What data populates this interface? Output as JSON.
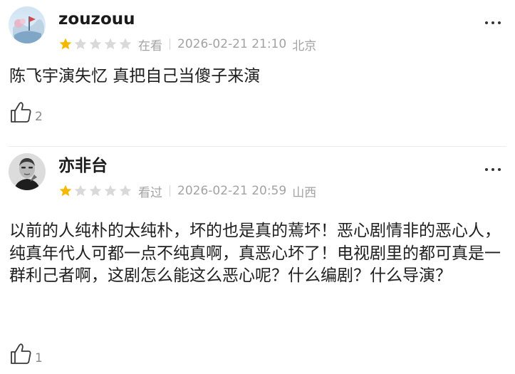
{
  "reviews": [
    {
      "username": "zouzouu",
      "rating": 1,
      "max_rating": 5,
      "status": "在看",
      "time": "2026-02-21 21:10",
      "location": "北京",
      "content": "陈飞宇演失忆 真把自己当傻子来演",
      "likes": "2"
    },
    {
      "username": "亦非台",
      "rating": 1,
      "max_rating": 5,
      "status": "看过",
      "time": "2026-02-21 20:59",
      "location": "山西",
      "content": "以前的人纯朴的太纯朴，坏的也是真的蔫坏！恶心剧情非的恶心人，纯真年代人可都一点不纯真啊，真恶心坏了！电视剧里的都可真是一群利己者啊，这剧怎么能这么恶心呢？什么编剧？什么导演？",
      "likes": "1"
    }
  ],
  "colors": {
    "star_filled": "#f5b800",
    "star_empty": "#d9d9d9",
    "meta_text": "#a3a3a3"
  },
  "icons": {
    "more": "more-dots-icon",
    "like": "thumbs-up-icon",
    "star": "star-icon"
  }
}
